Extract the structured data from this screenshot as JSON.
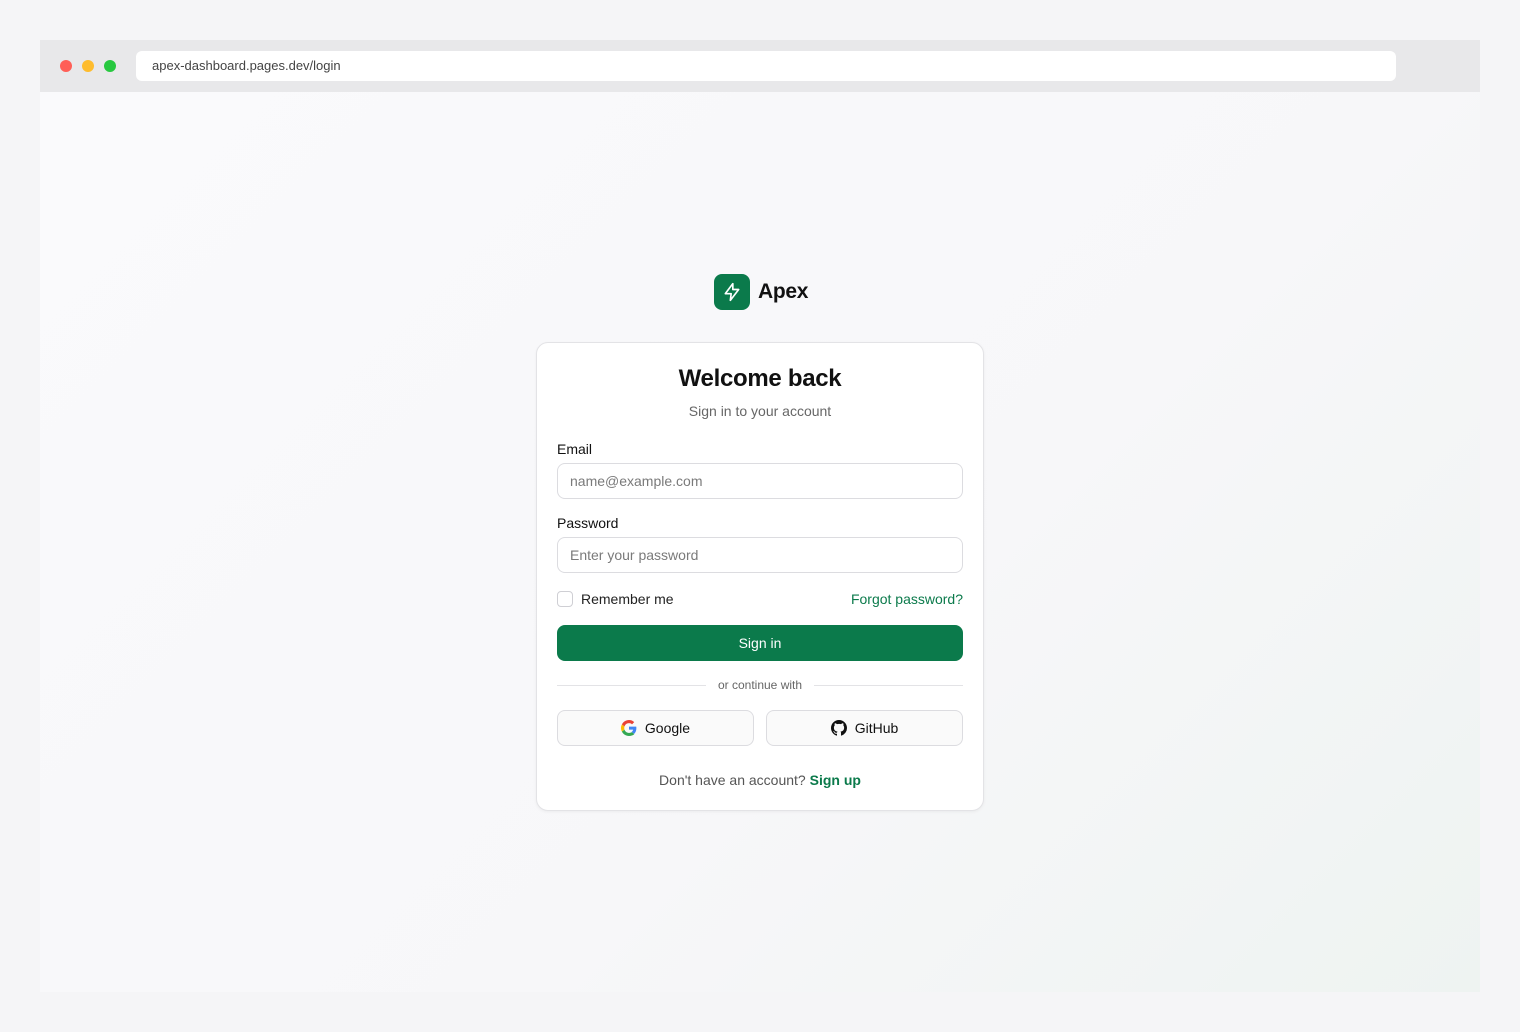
{
  "browser": {
    "url": "apex-dashboard.pages.dev/login"
  },
  "brand": {
    "name": "Apex",
    "logo_icon": "lightning-bolt-icon",
    "accent_color": "#0b7a4b"
  },
  "login": {
    "title": "Welcome back",
    "subtitle": "Sign in to your account",
    "email_label": "Email",
    "email_placeholder": "name@example.com",
    "email_value": "",
    "password_label": "Password",
    "password_placeholder": "Enter your password",
    "password_value": "",
    "remember_label": "Remember me",
    "remember_checked": false,
    "forgot_link": "Forgot password?",
    "submit_label": "Sign in",
    "divider_text": "or continue with",
    "social": [
      {
        "label": "Google",
        "icon": "google-icon"
      },
      {
        "label": "GitHub",
        "icon": "github-icon"
      }
    ],
    "footer_prompt": "Don't have an account?",
    "footer_link": "Sign up"
  }
}
